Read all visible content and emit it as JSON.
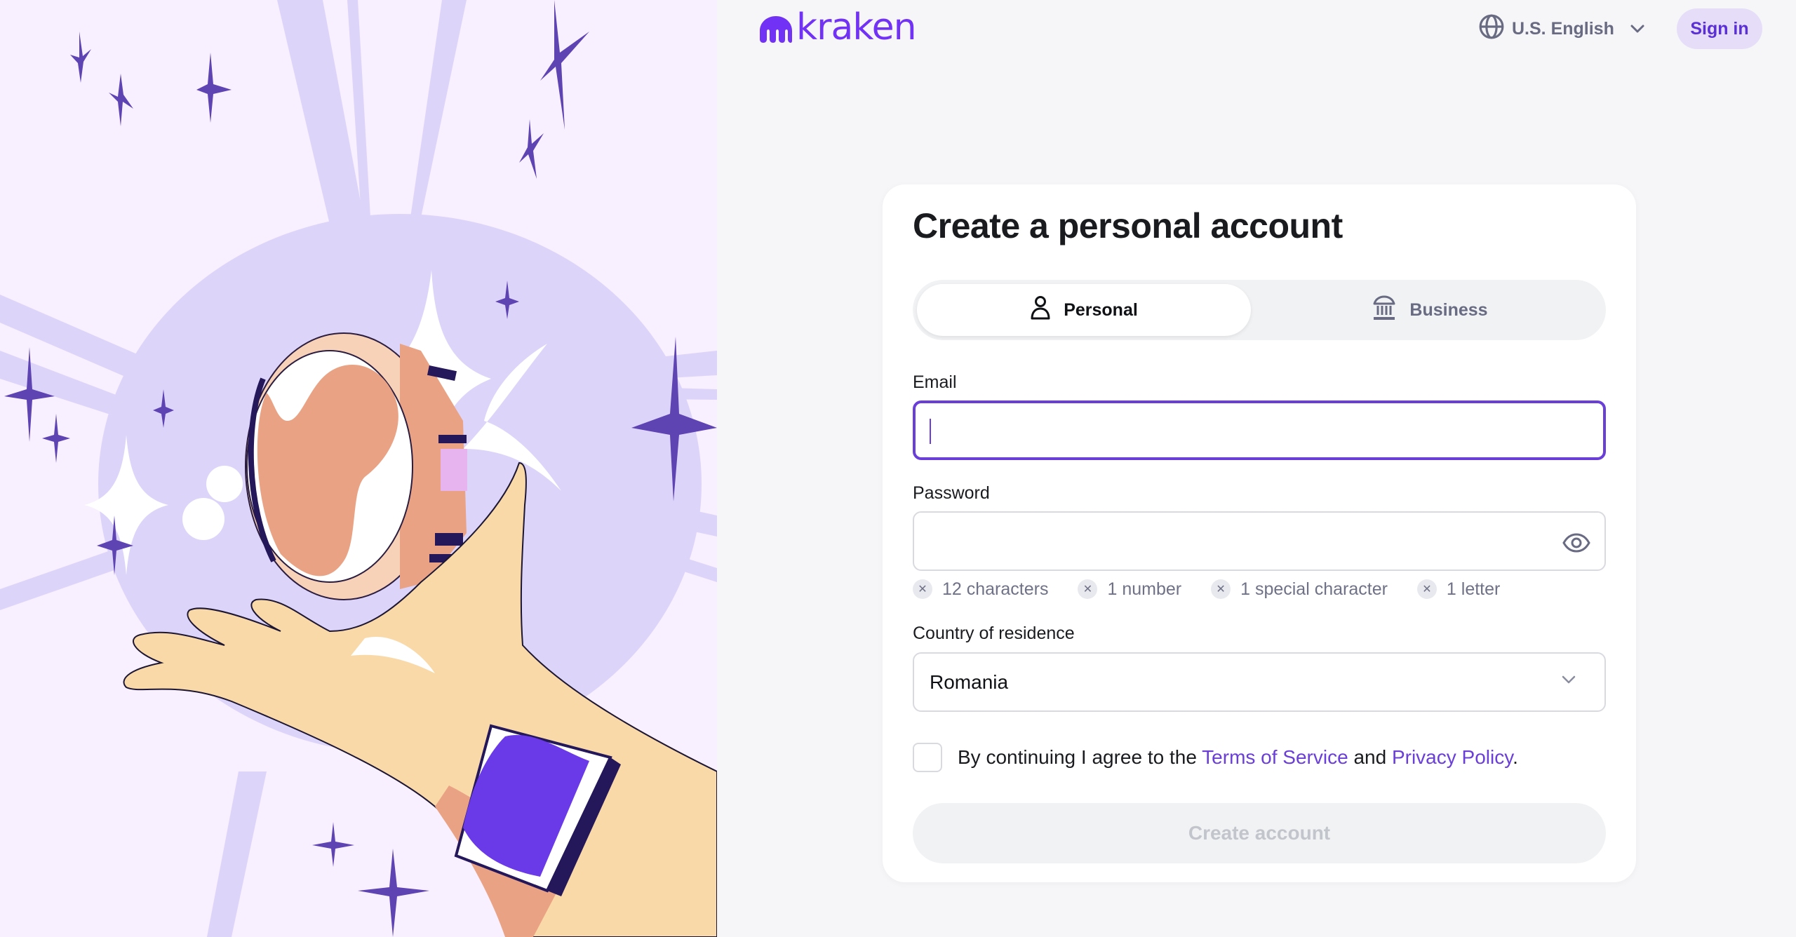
{
  "brand": {
    "name": "kraken",
    "color": "#7132f5"
  },
  "header": {
    "language": {
      "icon": "globe-icon",
      "label": "U.S. English",
      "chevron": "chevron-down-icon"
    },
    "signin_label": "Sign in"
  },
  "form": {
    "title": "Create a personal account",
    "account_types": [
      {
        "label": "Personal",
        "icon": "person-icon",
        "selected": true
      },
      {
        "label": "Business",
        "icon": "bank-icon",
        "selected": false
      }
    ],
    "email": {
      "label": "Email",
      "value": "",
      "focused": true
    },
    "password": {
      "label": "Password",
      "value": "",
      "visibility_icon": "eye-icon"
    },
    "password_rules": [
      {
        "label": "12 characters",
        "met": false
      },
      {
        "label": "1 number",
        "met": false
      },
      {
        "label": "1 special character",
        "met": false
      },
      {
        "label": "1 letter",
        "met": false
      }
    ],
    "country": {
      "label": "Country of residence",
      "value": "Romania"
    },
    "terms": {
      "checked": false,
      "prefix": "By continuing I agree to the ",
      "terms_link": "Terms of Service",
      "middle": " and ",
      "privacy_link": "Privacy Policy",
      "suffix": "."
    },
    "submit_label": "Create account",
    "submit_enabled": false
  },
  "colors": {
    "accent": "#6a3fd8",
    "signin_bg": "#e6def8",
    "page_bg": "#f6f6f8",
    "illustration_bg": "#f8efff"
  }
}
